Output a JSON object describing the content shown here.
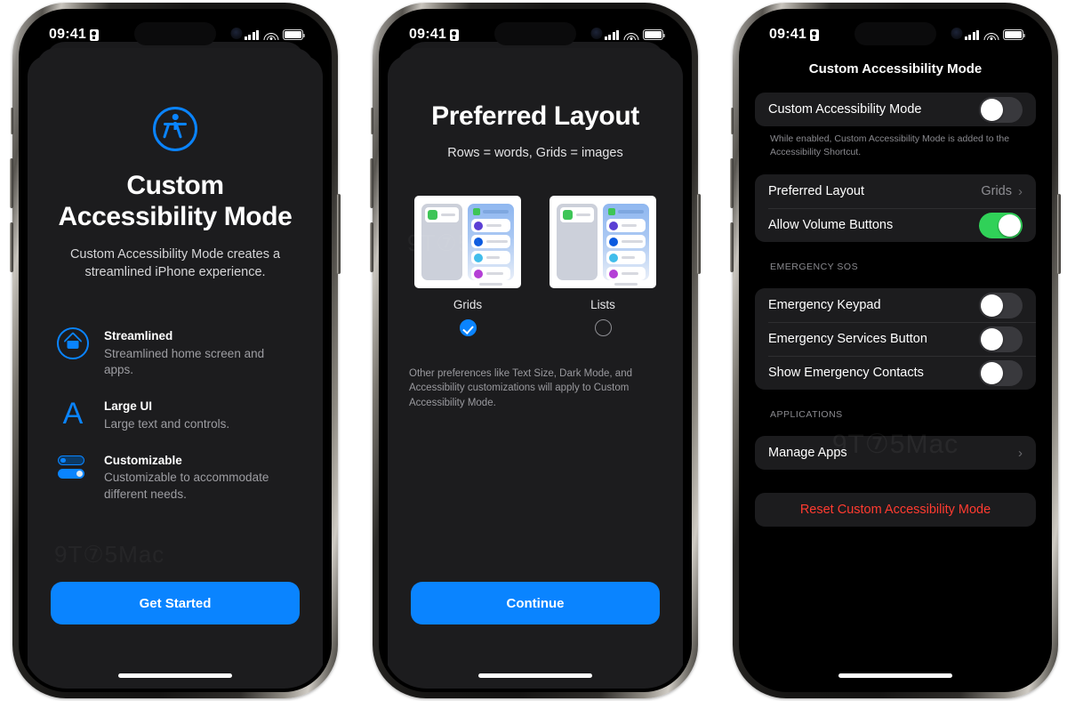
{
  "status_bar": {
    "time": "09:41",
    "lock_icon": "lock-portrait-icon",
    "signal_icon": "cellular-signal-icon",
    "wifi_icon": "wifi-icon",
    "battery_icon": "battery-full-icon"
  },
  "colors": {
    "accent_blue": "#0a84ff",
    "toggle_green": "#30d158",
    "destructive_red": "#ff3b30",
    "group_bg": "#1c1c1e",
    "screen_bg": "#000000"
  },
  "watermark": "9T⑦5Mac",
  "phone1": {
    "hero_icon": "accessibility-icon",
    "title": "Custom Accessibility Mode",
    "subtitle": "Custom Accessibility Mode creates a streamlined iPhone experience.",
    "features": [
      {
        "icon": "home-circle-icon",
        "title": "Streamlined",
        "desc": "Streamlined home screen and apps."
      },
      {
        "icon": "large-text-a-icon",
        "title": "Large UI",
        "desc": "Large text and controls."
      },
      {
        "icon": "sliders-icon",
        "title": "Customizable",
        "desc": "Customizable to accommodate different needs."
      }
    ],
    "cta_label": "Get Started"
  },
  "phone2": {
    "title": "Preferred Layout",
    "subtitle": "Rows = words, Grids = images",
    "options": [
      {
        "label": "Grids",
        "selected": true
      },
      {
        "label": "Lists",
        "selected": false
      }
    ],
    "footnote": "Other preferences like Text Size, Dark Mode, and Accessibility customizations will apply to Custom Accessibility Mode.",
    "cta_label": "Continue"
  },
  "phone3": {
    "nav_title": "Custom Accessibility Mode",
    "group1": {
      "rows": [
        {
          "label": "Custom Accessibility Mode",
          "type": "toggle",
          "value": "off"
        }
      ],
      "footnote": "While enabled, Custom Accessibility Mode is added to the Accessibility Shortcut."
    },
    "group2": {
      "rows": [
        {
          "label": "Preferred Layout",
          "type": "disclosure",
          "value": "Grids"
        },
        {
          "label": "Allow Volume Buttons",
          "type": "toggle",
          "value": "on"
        }
      ]
    },
    "group3": {
      "header": "EMERGENCY SOS",
      "rows": [
        {
          "label": "Emergency Keypad",
          "type": "toggle",
          "value": "off"
        },
        {
          "label": "Emergency Services Button",
          "type": "toggle",
          "value": "off"
        },
        {
          "label": "Show Emergency Contacts",
          "type": "toggle",
          "value": "off"
        }
      ]
    },
    "group4": {
      "header": "APPLICATIONS",
      "rows": [
        {
          "label": "Manage Apps",
          "type": "disclosure",
          "value": ""
        }
      ]
    },
    "reset_label": "Reset Custom Accessibility Mode"
  }
}
